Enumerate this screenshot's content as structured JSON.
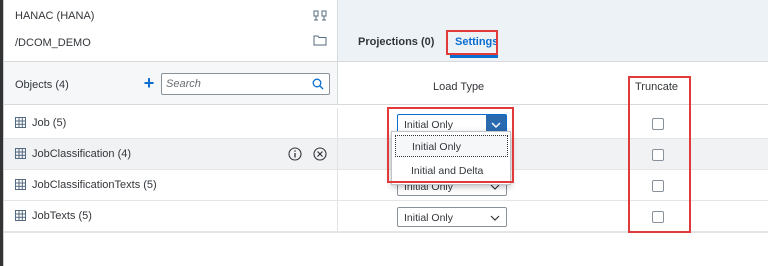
{
  "source": {
    "connection_label": "HANAC (HANA)",
    "schema_label": "/DCOM_DEMO"
  },
  "tabs": {
    "projections_label": "Projections (0)",
    "settings_label": "Settings",
    "active": "Settings"
  },
  "objects": {
    "header_label": "Objects (4)",
    "search_placeholder": "Search"
  },
  "columns": {
    "load_type": "Load Type",
    "truncate": "Truncate"
  },
  "rows": [
    {
      "name": "Job (5)",
      "load_type": "Initial Only",
      "truncate": false
    },
    {
      "name": "JobClassification (4)",
      "load_type": "Initial Only",
      "truncate": false
    },
    {
      "name": "JobClassificationTexts (5)",
      "load_type": "Initial Only",
      "truncate": false
    },
    {
      "name": "JobTexts (5)",
      "load_type": "Initial Only",
      "truncate": false
    }
  ],
  "dropdown": {
    "options": [
      "Initial Only",
      "Initial and Delta"
    ],
    "focused": "Initial Only"
  },
  "colors": {
    "accent": "#0a6ed1",
    "highlight": "#e03a3a",
    "header_bg": "#edf2f6"
  }
}
